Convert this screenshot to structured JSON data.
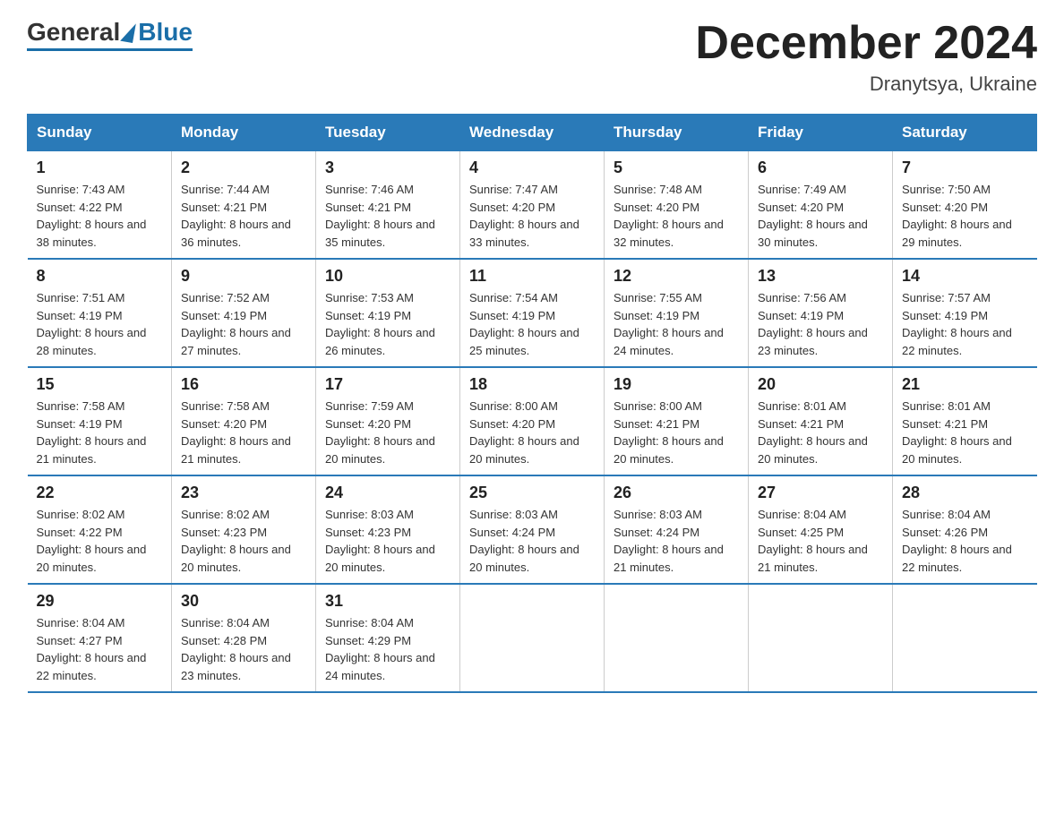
{
  "header": {
    "logo_text_general": "General",
    "logo_text_blue": "Blue",
    "month_title": "December 2024",
    "location": "Dranytsya, Ukraine"
  },
  "weekdays": [
    "Sunday",
    "Monday",
    "Tuesday",
    "Wednesday",
    "Thursday",
    "Friday",
    "Saturday"
  ],
  "weeks": [
    [
      {
        "day": "1",
        "sunrise": "7:43 AM",
        "sunset": "4:22 PM",
        "daylight": "8 hours and 38 minutes."
      },
      {
        "day": "2",
        "sunrise": "7:44 AM",
        "sunset": "4:21 PM",
        "daylight": "8 hours and 36 minutes."
      },
      {
        "day": "3",
        "sunrise": "7:46 AM",
        "sunset": "4:21 PM",
        "daylight": "8 hours and 35 minutes."
      },
      {
        "day": "4",
        "sunrise": "7:47 AM",
        "sunset": "4:20 PM",
        "daylight": "8 hours and 33 minutes."
      },
      {
        "day": "5",
        "sunrise": "7:48 AM",
        "sunset": "4:20 PM",
        "daylight": "8 hours and 32 minutes."
      },
      {
        "day": "6",
        "sunrise": "7:49 AM",
        "sunset": "4:20 PM",
        "daylight": "8 hours and 30 minutes."
      },
      {
        "day": "7",
        "sunrise": "7:50 AM",
        "sunset": "4:20 PM",
        "daylight": "8 hours and 29 minutes."
      }
    ],
    [
      {
        "day": "8",
        "sunrise": "7:51 AM",
        "sunset": "4:19 PM",
        "daylight": "8 hours and 28 minutes."
      },
      {
        "day": "9",
        "sunrise": "7:52 AM",
        "sunset": "4:19 PM",
        "daylight": "8 hours and 27 minutes."
      },
      {
        "day": "10",
        "sunrise": "7:53 AM",
        "sunset": "4:19 PM",
        "daylight": "8 hours and 26 minutes."
      },
      {
        "day": "11",
        "sunrise": "7:54 AM",
        "sunset": "4:19 PM",
        "daylight": "8 hours and 25 minutes."
      },
      {
        "day": "12",
        "sunrise": "7:55 AM",
        "sunset": "4:19 PM",
        "daylight": "8 hours and 24 minutes."
      },
      {
        "day": "13",
        "sunrise": "7:56 AM",
        "sunset": "4:19 PM",
        "daylight": "8 hours and 23 minutes."
      },
      {
        "day": "14",
        "sunrise": "7:57 AM",
        "sunset": "4:19 PM",
        "daylight": "8 hours and 22 minutes."
      }
    ],
    [
      {
        "day": "15",
        "sunrise": "7:58 AM",
        "sunset": "4:19 PM",
        "daylight": "8 hours and 21 minutes."
      },
      {
        "day": "16",
        "sunrise": "7:58 AM",
        "sunset": "4:20 PM",
        "daylight": "8 hours and 21 minutes."
      },
      {
        "day": "17",
        "sunrise": "7:59 AM",
        "sunset": "4:20 PM",
        "daylight": "8 hours and 20 minutes."
      },
      {
        "day": "18",
        "sunrise": "8:00 AM",
        "sunset": "4:20 PM",
        "daylight": "8 hours and 20 minutes."
      },
      {
        "day": "19",
        "sunrise": "8:00 AM",
        "sunset": "4:21 PM",
        "daylight": "8 hours and 20 minutes."
      },
      {
        "day": "20",
        "sunrise": "8:01 AM",
        "sunset": "4:21 PM",
        "daylight": "8 hours and 20 minutes."
      },
      {
        "day": "21",
        "sunrise": "8:01 AM",
        "sunset": "4:21 PM",
        "daylight": "8 hours and 20 minutes."
      }
    ],
    [
      {
        "day": "22",
        "sunrise": "8:02 AM",
        "sunset": "4:22 PM",
        "daylight": "8 hours and 20 minutes."
      },
      {
        "day": "23",
        "sunrise": "8:02 AM",
        "sunset": "4:23 PM",
        "daylight": "8 hours and 20 minutes."
      },
      {
        "day": "24",
        "sunrise": "8:03 AM",
        "sunset": "4:23 PM",
        "daylight": "8 hours and 20 minutes."
      },
      {
        "day": "25",
        "sunrise": "8:03 AM",
        "sunset": "4:24 PM",
        "daylight": "8 hours and 20 minutes."
      },
      {
        "day": "26",
        "sunrise": "8:03 AM",
        "sunset": "4:24 PM",
        "daylight": "8 hours and 21 minutes."
      },
      {
        "day": "27",
        "sunrise": "8:04 AM",
        "sunset": "4:25 PM",
        "daylight": "8 hours and 21 minutes."
      },
      {
        "day": "28",
        "sunrise": "8:04 AM",
        "sunset": "4:26 PM",
        "daylight": "8 hours and 22 minutes."
      }
    ],
    [
      {
        "day": "29",
        "sunrise": "8:04 AM",
        "sunset": "4:27 PM",
        "daylight": "8 hours and 22 minutes."
      },
      {
        "day": "30",
        "sunrise": "8:04 AM",
        "sunset": "4:28 PM",
        "daylight": "8 hours and 23 minutes."
      },
      {
        "day": "31",
        "sunrise": "8:04 AM",
        "sunset": "4:29 PM",
        "daylight": "8 hours and 24 minutes."
      },
      null,
      null,
      null,
      null
    ]
  ],
  "labels": {
    "sunrise": "Sunrise:",
    "sunset": "Sunset:",
    "daylight": "Daylight:"
  }
}
